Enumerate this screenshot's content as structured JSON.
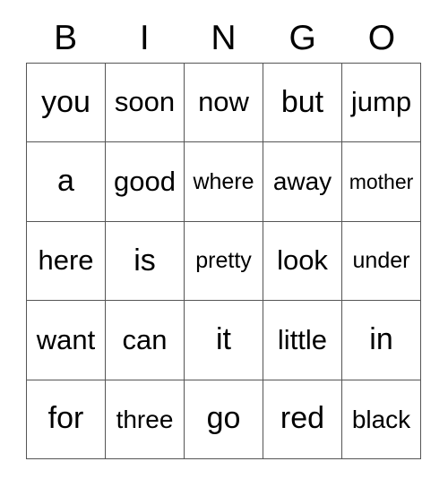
{
  "card": {
    "header": {
      "letters": [
        "B",
        "I",
        "N",
        "G",
        "O"
      ]
    },
    "grid": {
      "rows": 5,
      "columns": 5,
      "border_color": "#555555",
      "background_color": "#ffffff",
      "text_color": "#000000",
      "cells": [
        [
          {
            "word": "you",
            "size": "fs-xl"
          },
          {
            "word": "soon",
            "size": "fs-lg"
          },
          {
            "word": "now",
            "size": "fs-lg"
          },
          {
            "word": "but",
            "size": "fs-xl"
          },
          {
            "word": "jump",
            "size": "fs-lg"
          }
        ],
        [
          {
            "word": "a",
            "size": "fs-xl"
          },
          {
            "word": "good",
            "size": "fs-lg"
          },
          {
            "word": "where",
            "size": "fs-sm"
          },
          {
            "word": "away",
            "size": "fs-md"
          },
          {
            "word": "mother",
            "size": "fs-xs"
          }
        ],
        [
          {
            "word": "here",
            "size": "fs-lg"
          },
          {
            "word": "is",
            "size": "fs-xl"
          },
          {
            "word": "pretty",
            "size": "fs-sm"
          },
          {
            "word": "look",
            "size": "fs-lg"
          },
          {
            "word": "under",
            "size": "fs-sm"
          }
        ],
        [
          {
            "word": "want",
            "size": "fs-lg"
          },
          {
            "word": "can",
            "size": "fs-lg"
          },
          {
            "word": "it",
            "size": "fs-xl"
          },
          {
            "word": "little",
            "size": "fs-lg"
          },
          {
            "word": "in",
            "size": "fs-xl"
          }
        ],
        [
          {
            "word": "for",
            "size": "fs-xl"
          },
          {
            "word": "three",
            "size": "fs-md"
          },
          {
            "word": "go",
            "size": "fs-xl"
          },
          {
            "word": "red",
            "size": "fs-xl"
          },
          {
            "word": "black",
            "size": "fs-md"
          }
        ]
      ]
    }
  }
}
